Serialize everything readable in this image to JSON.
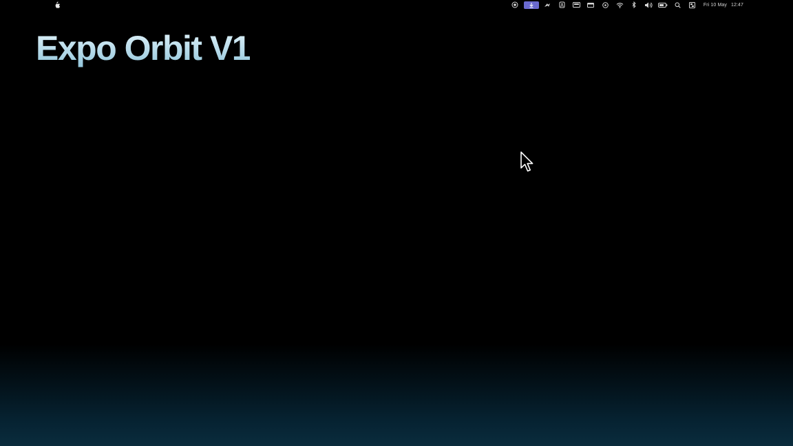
{
  "menubar": {
    "status_icons": [
      {
        "name": "screen-record-icon",
        "glyph": "⊙"
      },
      {
        "name": "download-icon",
        "glyph": "↓",
        "highlight": true,
        "color": "#6a6ad0"
      },
      {
        "name": "arrow-app-icon",
        "glyph": "➶"
      },
      {
        "name": "lock-app-icon",
        "glyph": "⌂"
      },
      {
        "name": "display-icon",
        "glyph": "▭"
      },
      {
        "name": "window-icon",
        "glyph": "▬"
      },
      {
        "name": "target-icon",
        "glyph": "◎"
      },
      {
        "name": "wifi-icon",
        "glyph": "wifi"
      },
      {
        "name": "bluetooth-icon",
        "glyph": "ᛒ"
      },
      {
        "name": "volume-icon",
        "glyph": "🔊"
      },
      {
        "name": "battery-icon",
        "glyph": "▭"
      },
      {
        "name": "search-icon",
        "glyph": "⌕"
      },
      {
        "name": "control-center-icon",
        "glyph": "▣"
      }
    ],
    "date": "Fri 10 May",
    "time": "12:47"
  },
  "desktop": {
    "title": "Expo Orbit V1",
    "title_color": "#bfe0ee",
    "background_color": "#000000",
    "glow_color": "#0a2c3d"
  }
}
